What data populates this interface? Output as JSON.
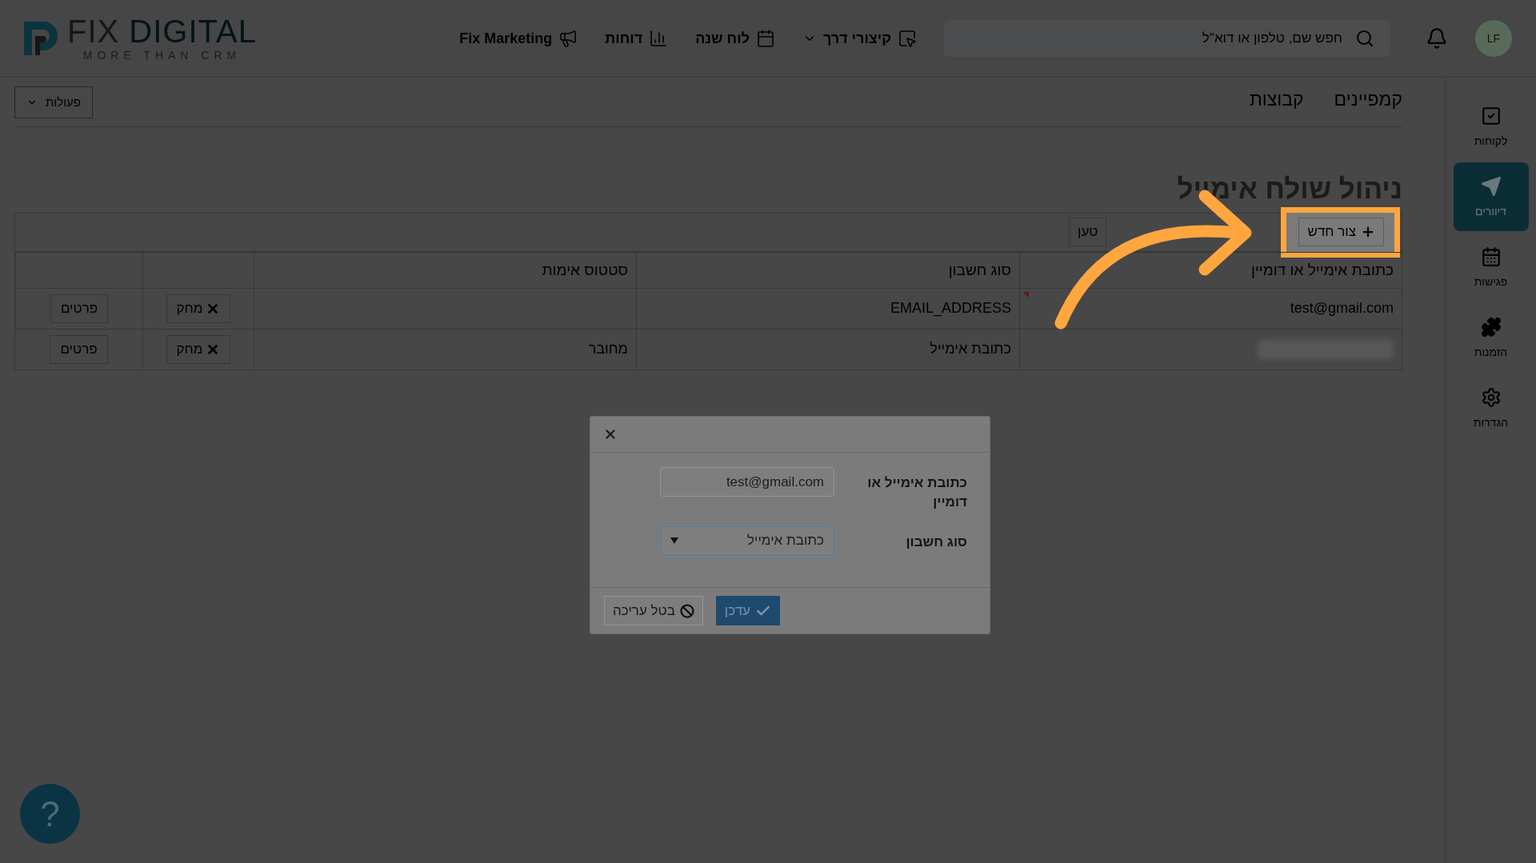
{
  "logo": {
    "name_first": "FIX",
    "name_second": "DIGITAL",
    "tagline": "MORE THAN CRM"
  },
  "nav": [
    {
      "label": "קיצורי דרך",
      "dropdown": true
    },
    {
      "label": "לוח שנה",
      "dropdown": false
    },
    {
      "label": "דוחות",
      "dropdown": false
    },
    {
      "label": "Fix Marketing",
      "dropdown": false
    }
  ],
  "search": {
    "placeholder": "חפש שם, טלפון או דוא\"ל"
  },
  "avatar": {
    "initials": "LF"
  },
  "sidebar": {
    "items": [
      {
        "label": "לקוחות",
        "selected": false
      },
      {
        "label": "דיוורים",
        "selected": true
      },
      {
        "label": "פגישות",
        "selected": false
      },
      {
        "label": "הזמנות",
        "selected": false
      },
      {
        "label": "הגדרות",
        "selected": false
      }
    ]
  },
  "tabs": [
    {
      "label": "קמפיינים",
      "selected": false
    },
    {
      "label": "קבוצות",
      "selected": false
    }
  ],
  "actions_menu": {
    "label": "פעולות"
  },
  "title": "ניהול שולח אימייל",
  "toolbar": {
    "buttons": [
      {
        "label": "צור חדש",
        "highlighted": true
      },
      {
        "label": "טען",
        "highlighted": false
      }
    ]
  },
  "table": {
    "columns": [
      "כתובת אימייל או דומיין",
      "סוג חשבון",
      "סטטוס אימות"
    ],
    "rows": [
      {
        "email": "test@gmail.com",
        "changed": true,
        "type": "EMAIL_ADDRESS",
        "delete_label": "מחק",
        "details_label": "פרטים"
      },
      {
        "email_blurred": true,
        "changed": false,
        "type": "כתובת אימייל",
        "status": "מחובר",
        "delete_label": "מחק",
        "details_label": "פרטים"
      }
    ]
  },
  "modal": {
    "fields": [
      {
        "kind": "text",
        "label": "כתובת אימייל או דומיין",
        "value": "test@gmail.com",
        "focused": false
      },
      {
        "kind": "select",
        "label": "סוג חשבון",
        "value": "כתובת אימייל",
        "focused": true
      }
    ],
    "buttons": [
      {
        "kind": "primary",
        "label": "עדכן"
      },
      {
        "kind": "secondary",
        "label": "בטל עריכה"
      }
    ]
  },
  "help": {
    "label": "?"
  }
}
